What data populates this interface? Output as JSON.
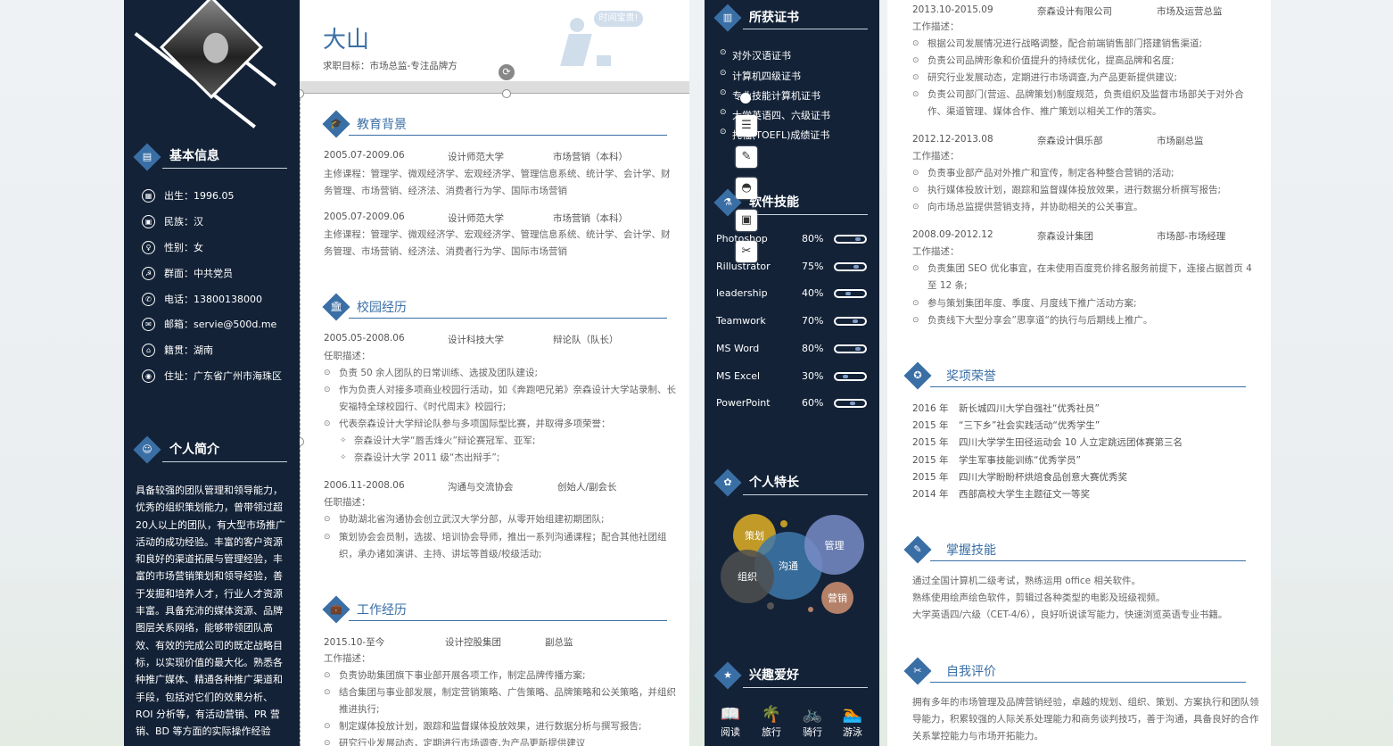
{
  "name": "大山",
  "objective": "求职目标：市场总监-专注品牌方",
  "speech": "时间宝贵!",
  "basic": {
    "title": "基本信息",
    "rows": [
      {
        "label": "出生：1996.05",
        "icon": "calendar-icon"
      },
      {
        "label": "民族：汉",
        "icon": "id-icon"
      },
      {
        "label": "性别：女",
        "icon": "gender-icon"
      },
      {
        "label": "群面：中共党员",
        "icon": "party-icon"
      },
      {
        "label": "电话：13800138000",
        "icon": "phone-icon"
      },
      {
        "label": "邮箱：servie@500d.me",
        "icon": "mail-icon"
      },
      {
        "label": "籍贯：湖南",
        "icon": "home-icon"
      },
      {
        "label": "住址：广东省广州市海珠区",
        "icon": "location-icon"
      }
    ]
  },
  "intro": {
    "title": "个人简介",
    "text": "具备较强的团队管理和领导能力，优秀的组织策划能力，曾带领过超20人以上的团队，有大型市场推广活动的成功经验。丰富的客户资源和良好的渠道拓展与管理经验，丰富的市场营销策划和领导经验，善于发掘和培养人才，行业人才资源丰富。具备充沛的媒体资源、品牌图层关系网络，能够带领团队高效、有效的完成公司的既定战略目标，以实现价值的最大化。熟悉各种推广媒体、精通各种推广渠道和手段，包括对它们的效果分析、ROI 分析等，有活动营销、PR 营销、BD 等方面的实际操作经验"
  },
  "edu": {
    "title": "教育背景",
    "items": [
      {
        "date": "2005.07-2009.06",
        "school": "设计师范大学",
        "major": "市场营销（本科）",
        "courses": "主修课程：管理学、微观经济学、宏观经济学、管理信息系统、统计学、会计学、财务管理、市场营销、经济法、消费者行为学、国际市场营销"
      },
      {
        "date": "2005.07-2009.06",
        "school": "设计师范大学",
        "major": "市场营销（本科）",
        "courses": "主修课程：管理学、微观经济学、宏观经济学、管理信息系统、统计学、会计学、财务管理、市场营销、经济法、消费者行为学、国际市场营销"
      }
    ]
  },
  "campus": {
    "title": "校园经历",
    "items": [
      {
        "date": "2005.05-2008.06",
        "org": "设计科技大学",
        "role": "辩论队（队长）",
        "desc": "任职描述：",
        "bullets": [
          "负责 50 余人团队的日常训练、选拔及团队建设;",
          "作为负责人对接多项商业校园行活动，如《奔跑吧兄弟》奈森设计大学站录制、长安福特全球校园行、《时代周末》校园行;",
          "代表奈森设计大学辩论队参与多项国际型比赛，并取得多项荣誉："
        ],
        "subs": [
          "奈森设计大学“唇舌烽火”辩论赛冠军、亚军;",
          "奈森设计大学 2011 级“杰出辩手”;"
        ]
      },
      {
        "date": "2006.11-2008.06",
        "org": "沟通与交流协会",
        "role": "创始人/副会长",
        "desc": "任职描述：",
        "bullets": [
          "协助湖北省沟通协会创立武汉大学分部，从零开始组建初期团队;",
          "策划协会会员制，选拔、培训协会导师，推出一系列沟通课程；配合其他社团组织，承办诸如演讲、主持、讲坛等首级/校级活动;"
        ]
      }
    ]
  },
  "work": {
    "title": "工作经历",
    "items": [
      {
        "date": "2015.10-至今",
        "org": "设计控股集团",
        "role": "副总监",
        "desc": "工作描述：",
        "bullets": [
          "负责协助集团旗下事业部开展各项工作，制定品牌传播方案;",
          "结合集团与事业部发展，制定营销策略、广告策略、品牌策略和公关策略，并组织推进执行;",
          "制定媒体投放计划，跟踪和监督媒体投放效果，进行数据分析与撰写报告;",
          "研究行业发展动态，定期进行市场调查,为产品更新提供建议"
        ]
      },
      {
        "date": "2013.10-2015.09",
        "org": "奈森设计有限公司",
        "role": "市场及运营总监",
        "desc": "工作描述：",
        "bullets": [
          "根据公司发展情况进行战略调整，配合前端销售部门搭建销售渠道;",
          "负责公司品牌形象和价值提升的持续优化，提高品牌和名度;",
          "研究行业发展动态，定期进行市场调查,为产品更新提供建议;",
          "负责公司部门(营运、品牌策划)制度规范，负责组织及监督市场部关于对外合作、渠道管理、媒体合作、推广策划以相关工作的落实。"
        ]
      },
      {
        "date": "2012.12-2013.08",
        "org": "奈森设计俱乐部",
        "role": "市场副总监",
        "desc": "工作描述：",
        "bullets": [
          "负责事业部产品对外推广和宣传，制定各种整合营销的活动;",
          "执行媒体投放计划，跟踪和监督媒体投放效果，进行数据分析撰写报告;",
          "向市场总监提供营销支持，并协助相关的公关事宜。"
        ]
      },
      {
        "date": "2008.09-2012.12",
        "org": "奈森设计集团",
        "role": "市场部-市场经理",
        "desc": "工作描述：",
        "bullets": [
          "负责集团 SEO 优化事宜，在未使用百度竞价排名服务前提下，连接占据首页 4 至 12 条;",
          "参与策划集团年度、季度、月度线下推广活动方案;",
          "负责线下大型分享会”思享道“的执行与后期线上推广。"
        ]
      }
    ]
  },
  "certs": {
    "title": "所获证书",
    "items": [
      "对外汉语证书",
      "计算机四级证书",
      "专业技能计算机证书",
      "大学英语四、六级证书",
      "托福(TOEFL)成绩证书"
    ]
  },
  "skills": {
    "title": "软件技能",
    "items": [
      {
        "name": "Photoshop",
        "pct": "80%",
        "value": 0.8
      },
      {
        "name": "Rillustrator",
        "pct": "75%",
        "value": 0.75
      },
      {
        "name": "leadership",
        "pct": "40%",
        "value": 0.4
      },
      {
        "name": "Teamwork",
        "pct": "70%",
        "value": 0.7
      },
      {
        "name": "MS Word",
        "pct": "80%",
        "value": 0.8
      },
      {
        "name": "MS Excel",
        "pct": "30%",
        "value": 0.3
      },
      {
        "name": "PowerPoint",
        "pct": "60%",
        "value": 0.6
      }
    ]
  },
  "traits": {
    "title": "个人特长",
    "items": [
      "策划",
      "沟通",
      "管理",
      "组织",
      "营销"
    ]
  },
  "hobbies": {
    "title": "兴趣爱好",
    "items": [
      {
        "label": "阅读",
        "icon": "book-icon"
      },
      {
        "label": "旅行",
        "icon": "palm-icon"
      },
      {
        "label": "骑行",
        "icon": "bike-icon"
      },
      {
        "label": "游泳",
        "icon": "swim-icon"
      }
    ]
  },
  "awards": {
    "title": "奖项荣誉",
    "items": [
      {
        "year": "2016 年",
        "text": "新长城四川大学自强社“优秀社员”"
      },
      {
        "year": "2015 年",
        "text": "“三下乡”社会实践活动“优秀学生”"
      },
      {
        "year": "2015 年",
        "text": "四川大学学生田径运动会 10 人立定跳远团体赛第三名"
      },
      {
        "year": "2015 年",
        "text": "学生军事技能训练“优秀学员”"
      },
      {
        "year": "2015 年",
        "text": "四川大学盼盼杯烘焙食品创意大赛优秀奖"
      },
      {
        "year": "2014 年",
        "text": "西部高校大学生主题征文一等奖"
      }
    ]
  },
  "mastery": {
    "title": "掌握技能",
    "lines": [
      "通过全国计算机二级考试，熟练运用 office 相关软件。",
      "熟练使用绘声绘色软件，剪辑过各种类型的电影及班级视频。",
      "大学英语四/六级（CET-4/6），良好听说读写能力，快速浏览英语专业书籍。"
    ]
  },
  "selfeval": {
    "title": "自我评价",
    "text": "拥有多年的市场管理及品牌营销经验，卓越的规划、组织、策划、方案执行和团队领导能力，积累较强的人际关系处理能力和商务谈判技巧，善于沟通，具备良好的合作关系掌控能力与市场开拓能力。"
  },
  "colors": {
    "navy": "#132237",
    "accent": "#3a6fa6"
  }
}
